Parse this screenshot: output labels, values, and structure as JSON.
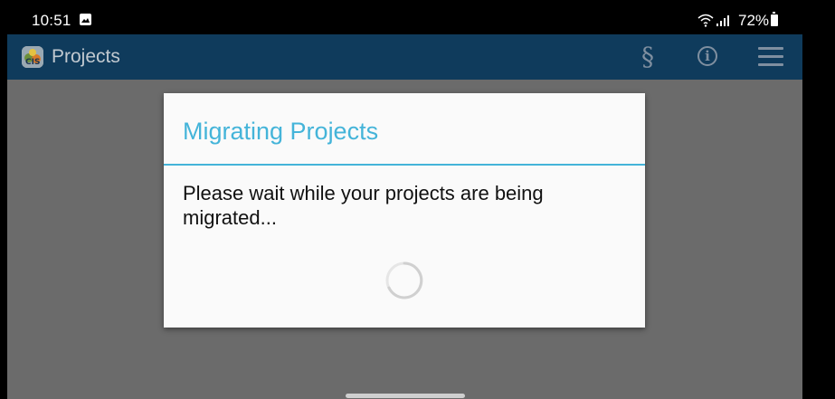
{
  "status_bar": {
    "time": "10:51",
    "battery_percent": "72%",
    "icons": [
      "gallery-icon",
      "wifi-icon",
      "signal-icon",
      "battery-icon"
    ]
  },
  "app_bar": {
    "title": "Projects",
    "section_symbol": "§",
    "info_symbol": "i",
    "icons": [
      "app-logo-icon",
      "section-icon",
      "info-icon",
      "menu-icon"
    ]
  },
  "dialog": {
    "title": "Migrating Projects",
    "message": "Please wait while your projects are being migrated..."
  },
  "colors": {
    "app_bar": "#0f3b5c",
    "accent": "#44b4d9",
    "scrim": "#6b6b6b"
  }
}
